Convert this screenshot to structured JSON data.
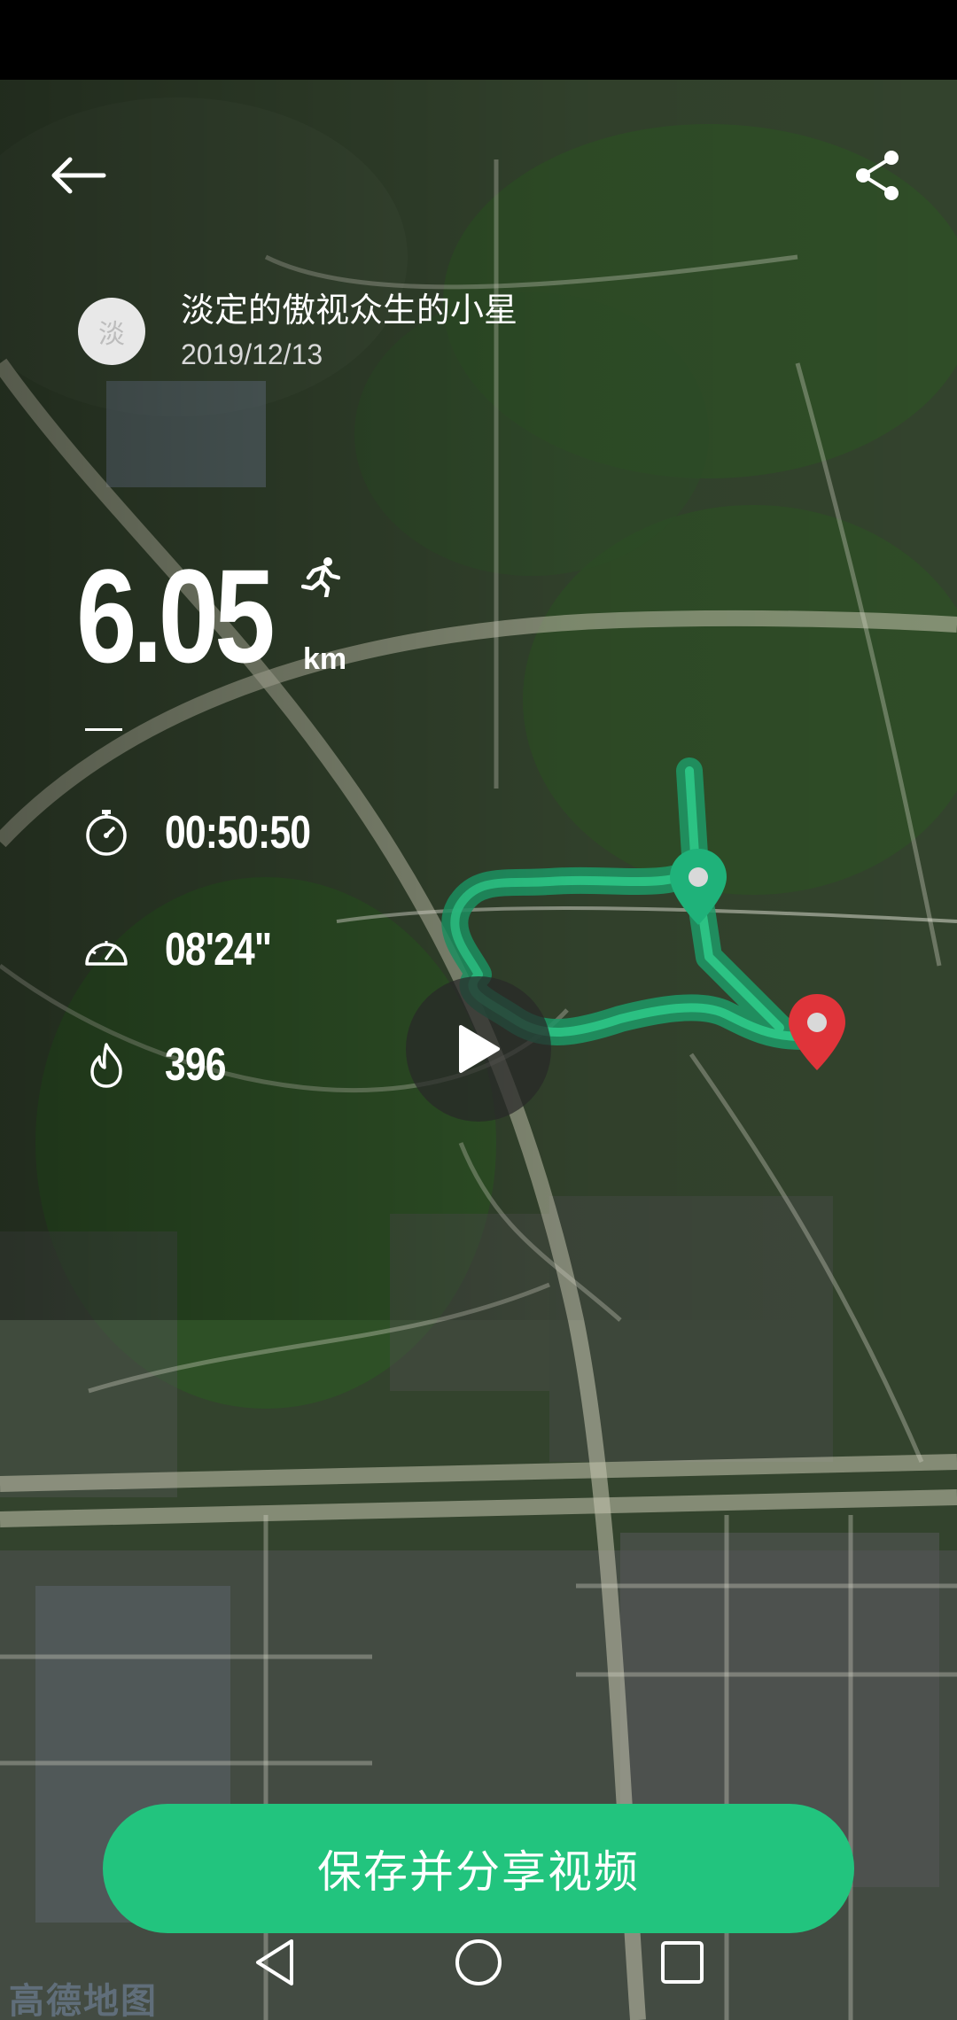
{
  "header": {
    "back_icon": "arrow-left-icon",
    "share_icon": "share-icon"
  },
  "profile": {
    "avatar_text": "淡",
    "username": "淡定的傲视众生的小星",
    "date": "2019/12/13"
  },
  "stats": {
    "distance": "6.05",
    "distance_unit": "km",
    "duration": "00:50:50",
    "pace": "08'24\"",
    "calories": "396",
    "icons": {
      "distance": "runner-icon",
      "duration": "stopwatch-icon",
      "pace": "speedometer-icon",
      "calories": "flame-icon"
    }
  },
  "map": {
    "logo_text": "高德地图",
    "play_icon": "play-icon",
    "start_marker": "start-pin-icon",
    "end_marker": "end-pin-icon",
    "route_color": "#1fb27a",
    "end_marker_color": "#e0343a"
  },
  "actions": {
    "save_share_label": "保存并分享视频",
    "accent_color": "#22c47e"
  },
  "navigation": {
    "back_icon": "nav-back-icon",
    "home_icon": "nav-home-icon",
    "recent_icon": "nav-recent-icon"
  }
}
